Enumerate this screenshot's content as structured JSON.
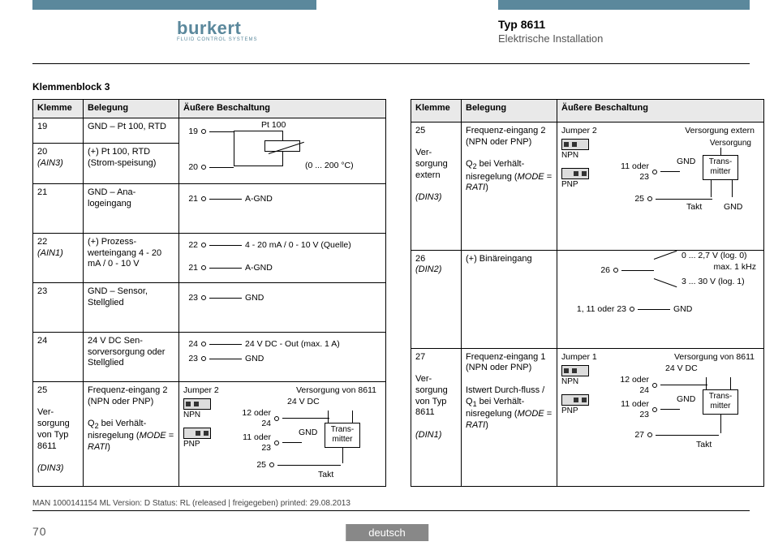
{
  "brand": {
    "name": "burkert",
    "tagline": "FLUID CONTROL SYSTEMS"
  },
  "doc": {
    "type": "Typ 8611",
    "section": "Elektrische Installation"
  },
  "section_title": "Klemmenblock 3",
  "headers": {
    "klemme": "Klemme",
    "belegung": "Belegung",
    "beschaltung": "Äußere Beschaltung"
  },
  "left": {
    "r1": {
      "klemme": "19",
      "belegung": "GND – Pt 100, RTD",
      "schem": {
        "p1": "19",
        "p2": "20",
        "top": "Pt 100",
        "range": "(0 ... 200 °C)"
      }
    },
    "r2": {
      "klemme_a": "20",
      "klemme_b": "(AIN3)",
      "belegung": "(+) Pt 100, RTD (Strom-speisung)"
    },
    "r3": {
      "klemme": "21",
      "belegung": "GND – Ana-logeingang",
      "schem": {
        "p": "21",
        "lbl": "A-GND"
      }
    },
    "r4": {
      "klemme_a": "22",
      "klemme_b": "(AIN1)",
      "belegung": "(+) Prozess-werteingang 4 - 20 mA / 0 - 10 V",
      "schem": {
        "p1": "22",
        "p2": "21",
        "lbl1": "4 - 20 mA / 0 - 10 V (Quelle)",
        "lbl2": "A-GND"
      }
    },
    "r5": {
      "klemme": "23",
      "belegung": "GND – Sensor, Stellglied",
      "schem": {
        "p": "23",
        "lbl": "GND"
      }
    },
    "r6": {
      "klemme": "24",
      "belegung": "24 V DC Sen-sorversorgung oder Stellglied",
      "schem": {
        "p1": "24",
        "p2": "23",
        "lbl1": "24 V DC - Out (max. 1 A)",
        "lbl2": "GND"
      }
    },
    "r7": {
      "klemme_a": "25",
      "klemme_b": "Ver-sorgung von Typ 8611",
      "klemme_c": "(DIN3)",
      "belegung_a": "Frequenz-eingang  2 (NPN oder PNP)",
      "belegung_b": "Q",
      "belegung_b_sub": "2",
      "belegung_b_tail": " bei Verhält-nisregelung (",
      "belegung_b_mode": "MODE = RATI",
      "belegung_b_close": ")",
      "schem": {
        "jumper_title": "Jumper 2",
        "npn": "NPN",
        "pnp": "PNP",
        "supply": "Versorgung von 8611",
        "p1": "12 oder 24",
        "p2": "11 oder 23",
        "p3": "25",
        "vdc": "24 V DC",
        "gnd": "GND",
        "box": "Trans-mitter",
        "takt": "Takt"
      }
    }
  },
  "right": {
    "r1": {
      "klemme_a": "25",
      "klemme_b": "Ver-sorgung extern",
      "klemme_c": "(DIN3)",
      "belegung_a": "Frequenz-eingang  2 (NPN oder PNP)",
      "belegung_b": "Q",
      "belegung_b_sub": "2",
      "belegung_b_tail": " bei Verhält-nisregelung (",
      "belegung_b_mode": "MODE = RATI",
      "belegung_b_close": ")",
      "schem": {
        "jumper_title": "Jumper 2",
        "npn": "NPN",
        "pnp": "PNP",
        "supply": "Versorgung extern",
        "vers": "Versorgung",
        "p1": "11 oder 23",
        "p2": "25",
        "gnd": "GND",
        "box": "Trans-mitter",
        "takt": "Takt",
        "gnd2": "GND"
      }
    },
    "r2": {
      "klemme_a": "26",
      "klemme_b": "(DIN2)",
      "belegung": "(+) Binäreingang",
      "schem": {
        "p": "26",
        "v0": "0 ... 2,7 V (log. 0)",
        "v1": "3 ... 30 V (log. 1)",
        "max": "max. 1 kHz",
        "pg": "1, 11 oder 23",
        "gnd": "GND"
      }
    },
    "r3": {
      "klemme_a": "27",
      "klemme_b": "Ver-sorgung von Typ 8611",
      "klemme_c": "(DIN1)",
      "belegung_a": "Frequenz-eingang  1 (NPN oder PNP)",
      "belegung_b_pre": "Istwert Durch-fluss / ",
      "belegung_b": "Q",
      "belegung_b_sub": "1",
      "belegung_b_tail": " bei Verhält-nisregelung (",
      "belegung_b_mode": "MODE = RATI",
      "belegung_b_close": ")",
      "schem": {
        "jumper_title": "Jumper 1",
        "npn": "NPN",
        "pnp": "PNP",
        "supply": "Versorgung von 8611",
        "p1": "12 oder 24",
        "p2": "11 oder 23",
        "p3": "27",
        "vdc": "24 V DC",
        "gnd": "GND",
        "box": "Trans-mitter",
        "takt": "Takt"
      }
    }
  },
  "footer": {
    "meta": "MAN 1000141154 ML Version: D Status: RL (released | freigegeben) printed: 29.08.2013",
    "page": "70",
    "lang": "deutsch"
  }
}
